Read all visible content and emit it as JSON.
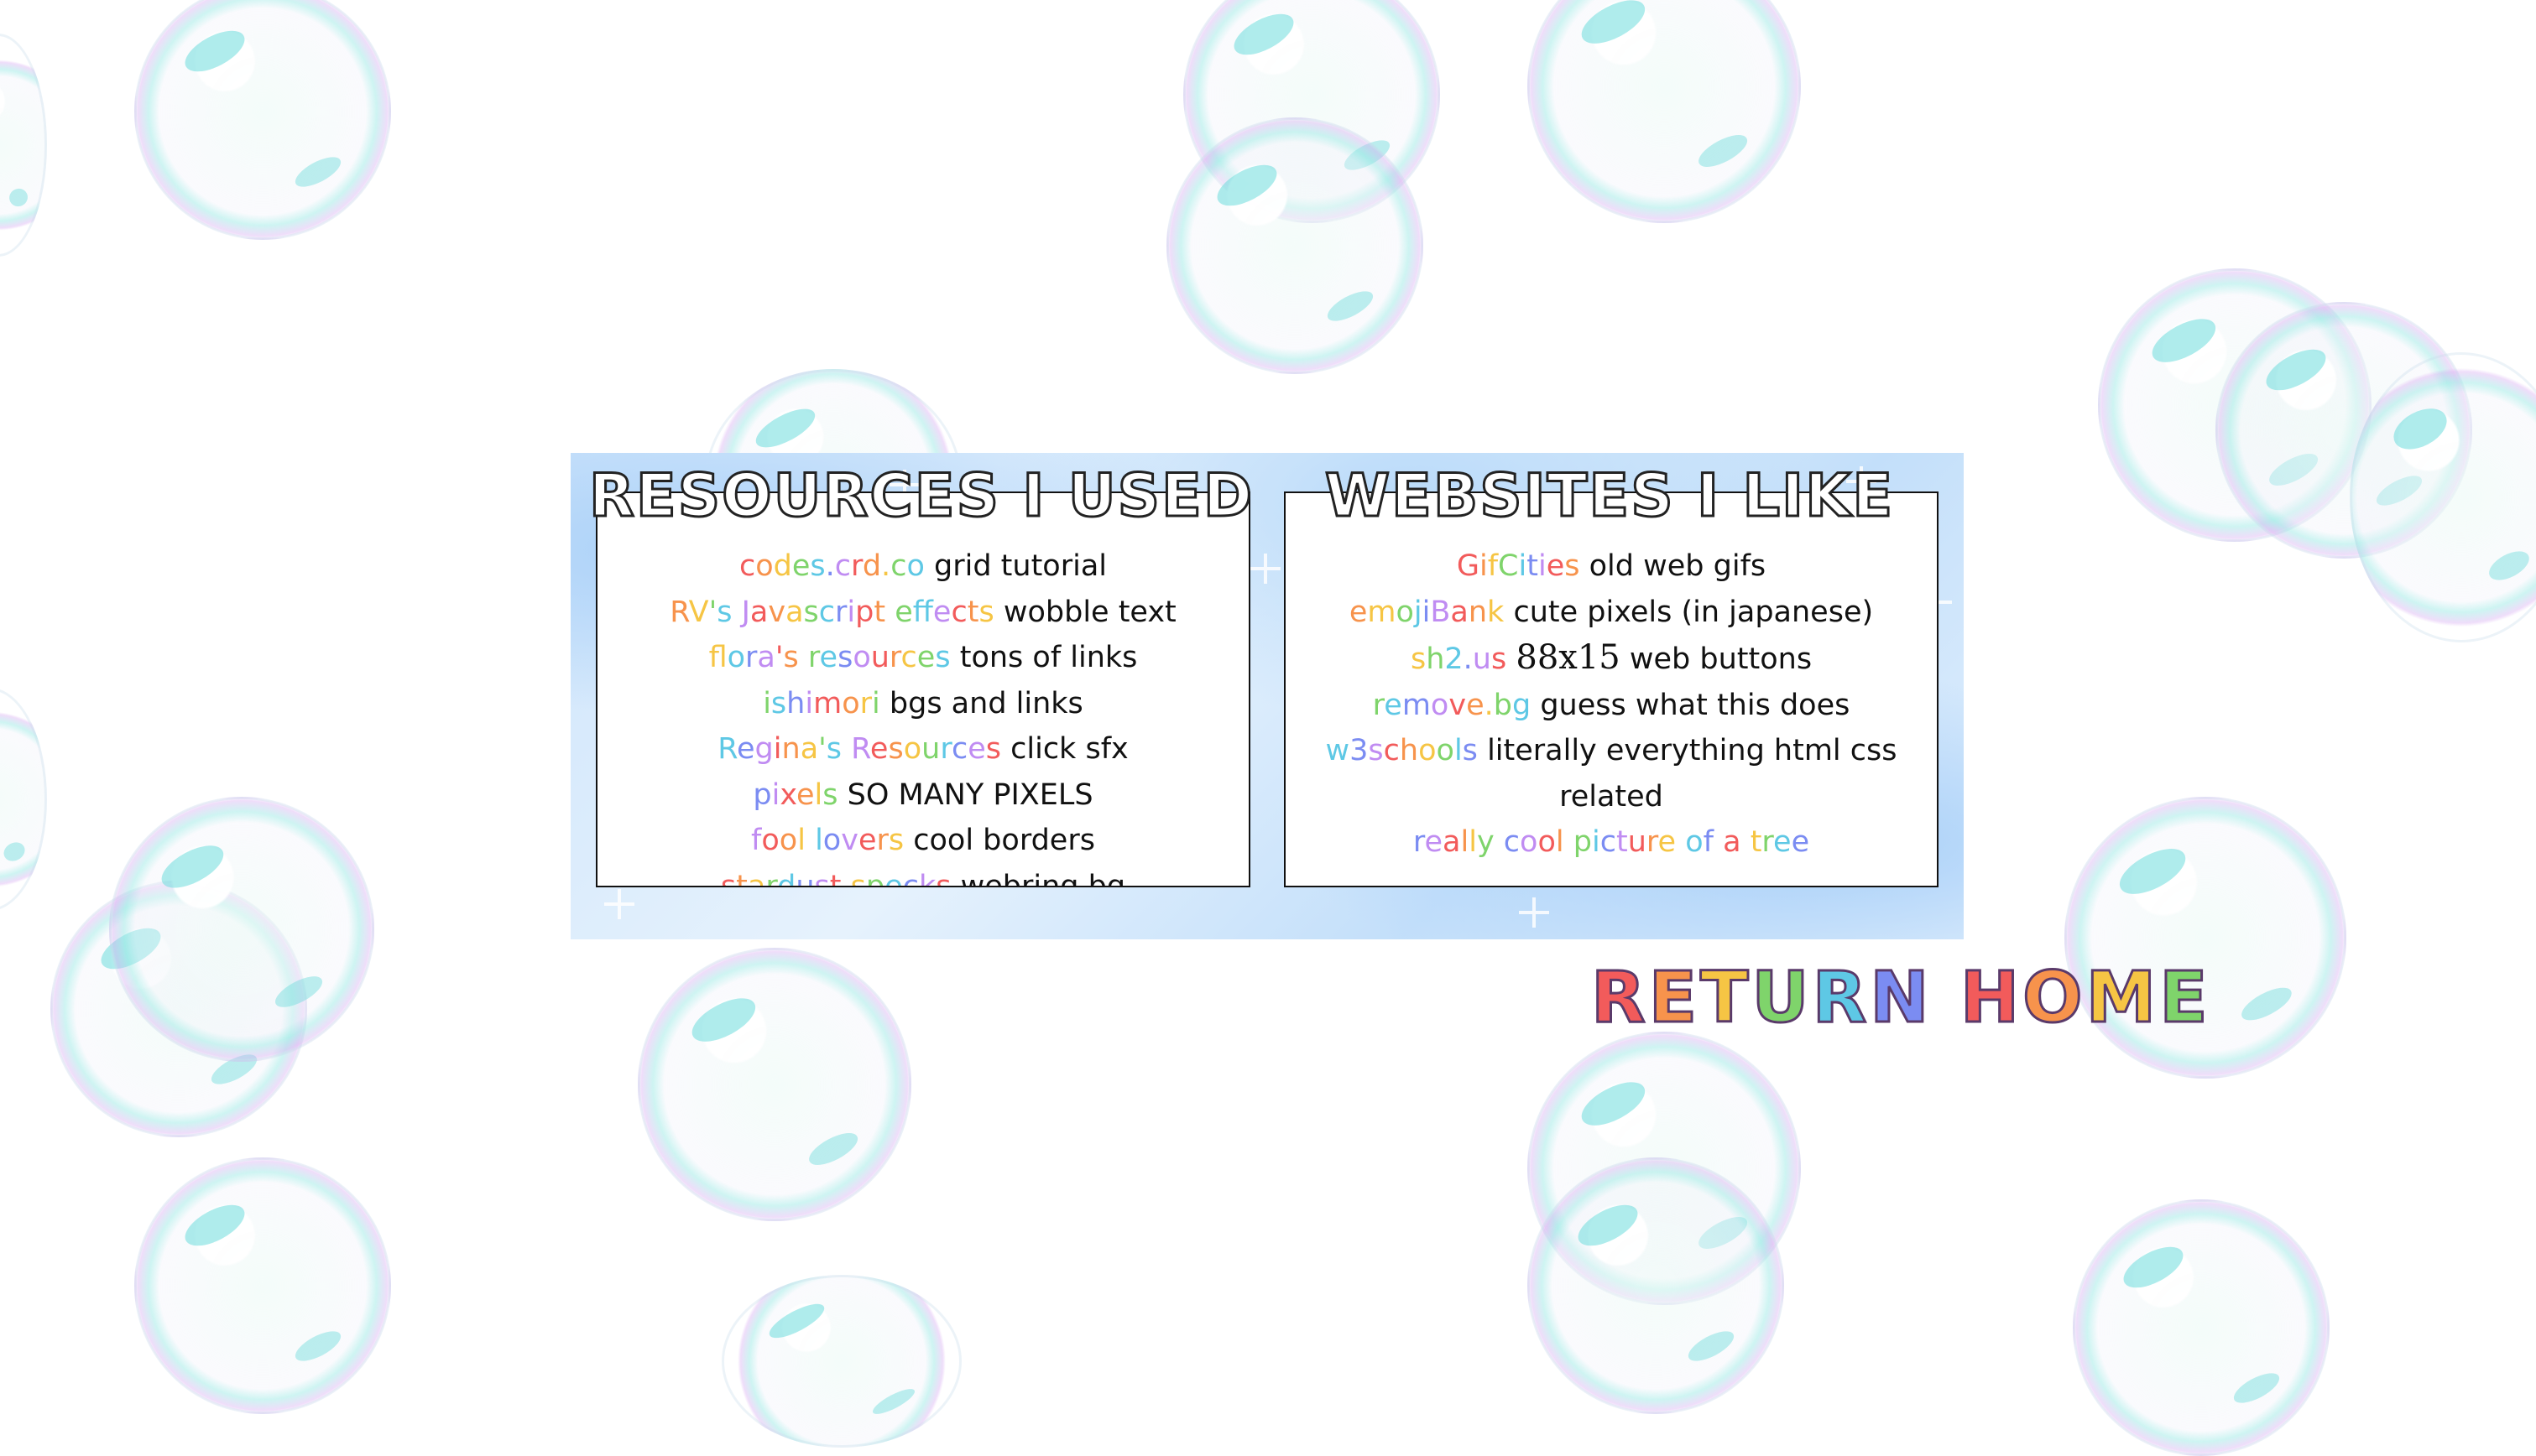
{
  "left_panel": {
    "title": "RESOURCES I USED",
    "items": [
      {
        "link": "codes.crd.co",
        "desc": "grid tutorial",
        "color": "#f4a261"
      },
      {
        "link": "RV's Javascript effects",
        "desc": "wobble text",
        "color": "#f28b82"
      },
      {
        "link": "flora's resources",
        "desc": "tons of links",
        "color": "#f4a261"
      },
      {
        "link": "ishimori",
        "desc": "bgs and links",
        "color": "#e879c8"
      },
      {
        "link": "Regina's Resources",
        "desc": "click sfx",
        "color": "#f28b82"
      },
      {
        "link": "pixels",
        "desc": "SO MANY PIXELS",
        "color": "#e879c8"
      },
      {
        "link": "fool lovers",
        "desc": "cool borders",
        "color": "#f4a261"
      },
      {
        "link": "stardust specks",
        "desc": "webring bg",
        "color": "#f28b82"
      }
    ]
  },
  "right_panel": {
    "title": "WEBSITES I LIKE",
    "items": [
      {
        "link": "GifCities",
        "desc": "old web gifs",
        "color": "#f4a261"
      },
      {
        "link": "emojiBank",
        "desc": "cute pixels (in japanese)",
        "color": "#f28b82"
      },
      {
        "link": "sh2.us",
        "desc_special": "88x15",
        "desc": "web buttons",
        "color": "#e8c84a"
      },
      {
        "link": "remove.bg",
        "desc": "guess what this does",
        "color": "#f28b82"
      },
      {
        "link": "w3schools",
        "desc": "literally everything html css related",
        "color": "#f4a261"
      },
      {
        "link": "really cool picture of a tree",
        "desc": "",
        "color": "#f28b82"
      }
    ]
  },
  "return_home": "RETURN HOME",
  "colors": {
    "rainbow": [
      "#f25b5b",
      "#f7934c",
      "#f6c544",
      "#7fd46b",
      "#5ec8e5",
      "#7b8cf2",
      "#c08cf2"
    ],
    "panel_blue": "#b9daf9"
  }
}
